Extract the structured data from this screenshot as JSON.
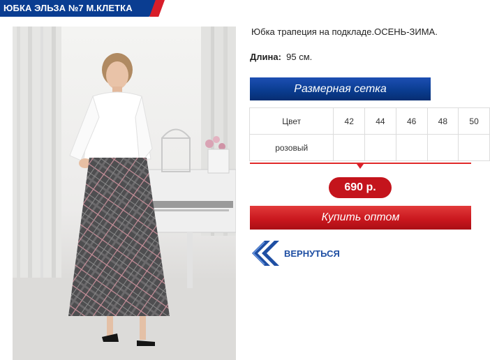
{
  "title": "ЮБКА ЭЛЬЗА №7 М.КЛЕТКА",
  "description": "Юбка трапеция на подкладе.ОСЕНЬ-ЗИМА.",
  "length": {
    "label": "Длина:",
    "value": "95 см."
  },
  "size_chart_button": "Размерная сетка",
  "size_table": {
    "header_label": "Цвет",
    "sizes": [
      "42",
      "44",
      "46",
      "48",
      "50"
    ],
    "rows": [
      {
        "color": "розовый",
        "cells": [
          "",
          "",
          "",
          "",
          ""
        ]
      }
    ]
  },
  "price": "690 р.",
  "buy_button": "Купить оптом",
  "back_label": "ВЕРНУТЬСЯ",
  "colors": {
    "brand_blue": "#0a3d91",
    "brand_red": "#c4141c",
    "link_blue": "#1f4fa3"
  },
  "icons": {
    "back": "double-chevron-left-icon"
  }
}
